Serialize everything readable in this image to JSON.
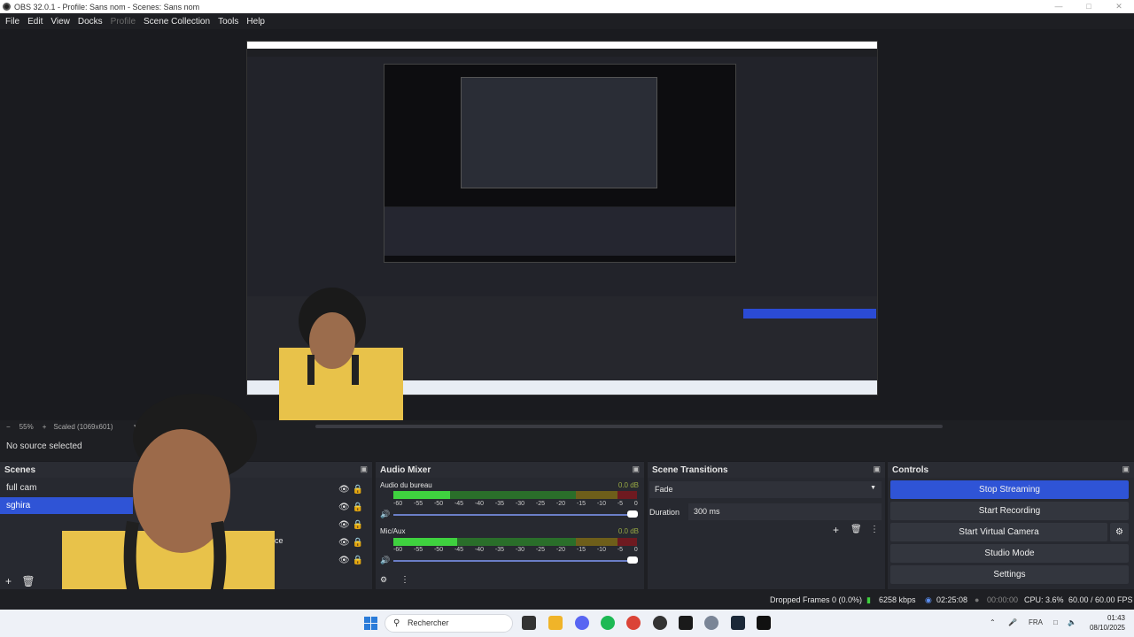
{
  "window": {
    "title": "OBS 32.0.1 - Profile: Sans nom - Scenes: Sans nom"
  },
  "menu": {
    "items": [
      {
        "label": "File",
        "enabled": true
      },
      {
        "label": "Edit",
        "enabled": true
      },
      {
        "label": "View",
        "enabled": true
      },
      {
        "label": "Docks",
        "enabled": true
      },
      {
        "label": "Profile",
        "enabled": false
      },
      {
        "label": "Scene Collection",
        "enabled": true
      },
      {
        "label": "Tools",
        "enabled": true
      },
      {
        "label": "Help",
        "enabled": true
      }
    ]
  },
  "preview_bar": {
    "zoom": "55%",
    "scale_label": "Scaled (1069x601)"
  },
  "source_bar": {
    "no_source": "No source selected"
  },
  "scenes": {
    "title": "Scenes",
    "items": [
      "full cam",
      "sghira"
    ],
    "selected": "sghira"
  },
  "sources": {
    "partial_label": "Device"
  },
  "audio_mixer": {
    "title": "Audio Mixer",
    "channels": [
      {
        "name": "Audio du bureau",
        "db": "0.0 dB",
        "level": 0.28
      },
      {
        "name": "Mic/Aux",
        "db": "0.0 dB",
        "level": 0.3
      }
    ],
    "ticks": [
      "-60",
      "-55",
      "-50",
      "-45",
      "-40",
      "-35",
      "-30",
      "-25",
      "-20",
      "-15",
      "-10",
      "-5",
      "0"
    ]
  },
  "scene_transitions": {
    "title": "Scene Transitions",
    "transition": "Fade",
    "duration_label": "Duration",
    "duration": "300 ms"
  },
  "controls": {
    "title": "Controls",
    "buttons": [
      "Stop Streaming",
      "Start Recording",
      "Start Virtual Camera",
      "Studio Mode",
      "Settings"
    ]
  },
  "status": {
    "dropped": "Dropped Frames 0 (0.0%)",
    "bitrate": "6258 kbps",
    "stream_time": "02:25:08",
    "rec_time": "00:00:00",
    "cpu": "CPU: 3.6%",
    "fps": "60.00 / 60.00 FPS"
  },
  "taskbar": {
    "search_placeholder": "Rechercher",
    "lang": "FRA",
    "time": "01:43",
    "date": "08/10/2025"
  },
  "colors": {
    "accent": "#2f54d6",
    "meter_green": "#3fd13f",
    "meter_yellow": "#c8b826",
    "meter_red": "#b0202a"
  }
}
